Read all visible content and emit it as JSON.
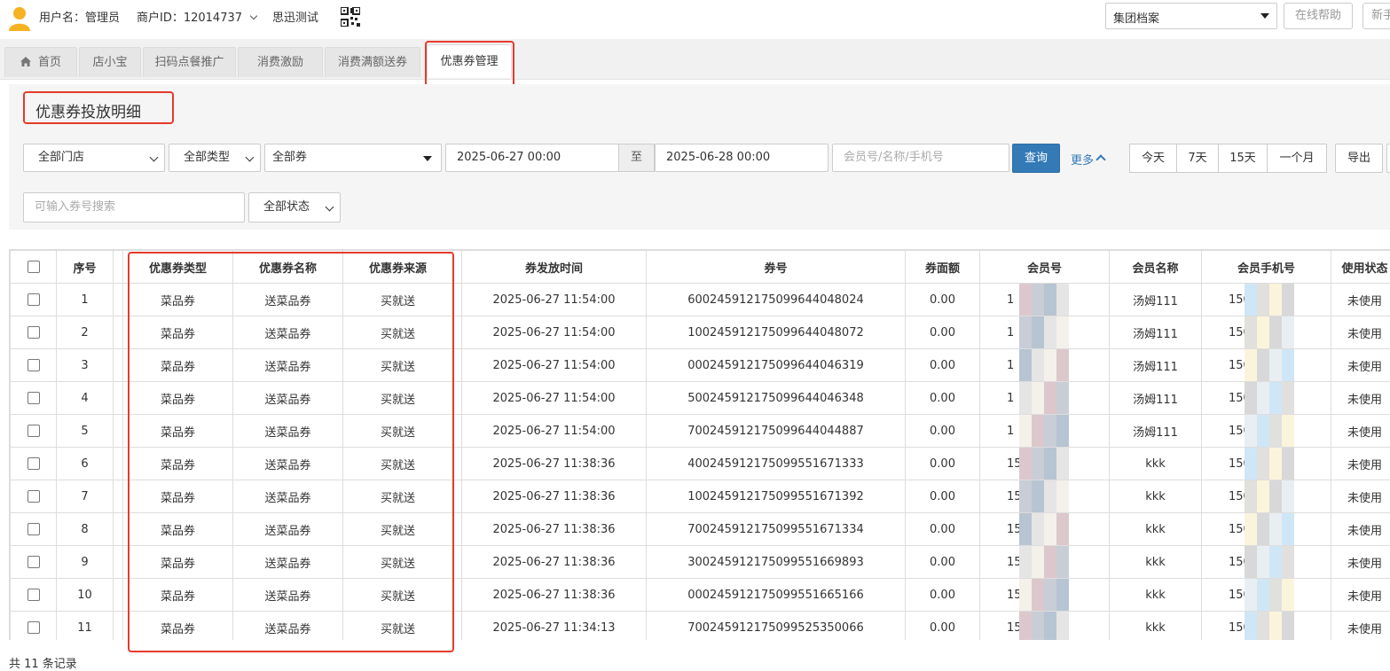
{
  "topbar": {
    "username": "用户名：管理员",
    "merchant_id": "商户ID：12014737",
    "store_name": "思迅测试",
    "group_select": "集团档案",
    "help_button": "在线帮助",
    "new_button": "新手"
  },
  "tabs": [
    {
      "label": "首页"
    },
    {
      "label": "店小宝"
    },
    {
      "label": "扫码点餐推广"
    },
    {
      "label": "消费激励"
    },
    {
      "label": "消费满额送券"
    },
    {
      "label": "优惠券管理"
    }
  ],
  "page_title": "优惠券投放明细",
  "filters": {
    "store": "全部门店",
    "type": "全部类型",
    "coupon": "全部券",
    "date_from": "2025-06-27 00:00",
    "date_to_label": "至",
    "date_to": "2025-06-28 00:00",
    "member_placeholder": "会员号/名称/手机号",
    "query_button": "查询",
    "more_link": "更多",
    "quick_ranges": [
      "今天",
      "7天",
      "15天",
      "一个月"
    ],
    "export_button": "导出",
    "coupon_no_placeholder": "可输入券号搜索",
    "status": "全部状态"
  },
  "table": {
    "headers": [
      "序号",
      "优惠券类型",
      "优惠券名称",
      "优惠券来源",
      "券发放时间",
      "券号",
      "券面额",
      "会员号",
      "会员名称",
      "会员手机号",
      "使用状态"
    ],
    "rows": [
      {
        "no": "1",
        "type": "菜品券",
        "name": "送菜品券",
        "source": "买就送",
        "time": "2025-06-27 11:54:00",
        "code": "600245912175099644048024",
        "amount": "0.00",
        "member_no": "1",
        "member_name": "汤姆111",
        "phone": "150",
        "status": "未使用"
      },
      {
        "no": "2",
        "type": "菜品券",
        "name": "送菜品券",
        "source": "买就送",
        "time": "2025-06-27 11:54:00",
        "code": "100245912175099644048072",
        "amount": "0.00",
        "member_no": "1",
        "member_name": "汤姆111",
        "phone": "150",
        "status": "未使用"
      },
      {
        "no": "3",
        "type": "菜品券",
        "name": "送菜品券",
        "source": "买就送",
        "time": "2025-06-27 11:54:00",
        "code": "000245912175099644046319",
        "amount": "0.00",
        "member_no": "1",
        "member_name": "汤姆111",
        "phone": "150",
        "status": "未使用"
      },
      {
        "no": "4",
        "type": "菜品券",
        "name": "送菜品券",
        "source": "买就送",
        "time": "2025-06-27 11:54:00",
        "code": "500245912175099644046348",
        "amount": "0.00",
        "member_no": "1",
        "member_name": "汤姆111",
        "phone": "150",
        "status": "未使用"
      },
      {
        "no": "5",
        "type": "菜品券",
        "name": "送菜品券",
        "source": "买就送",
        "time": "2025-06-27 11:54:00",
        "code": "700245912175099644044887",
        "amount": "0.00",
        "member_no": "1",
        "member_name": "汤姆111",
        "phone": "150",
        "status": "未使用"
      },
      {
        "no": "6",
        "type": "菜品券",
        "name": "送菜品券",
        "source": "买就送",
        "time": "2025-06-27 11:38:36",
        "code": "400245912175099551671333",
        "amount": "0.00",
        "member_no": "15",
        "member_name": "kkk",
        "phone": "150",
        "status": "未使用"
      },
      {
        "no": "7",
        "type": "菜品券",
        "name": "送菜品券",
        "source": "买就送",
        "time": "2025-06-27 11:38:36",
        "code": "100245912175099551671392",
        "amount": "0.00",
        "member_no": "15",
        "member_name": "kkk",
        "phone": "150",
        "status": "未使用"
      },
      {
        "no": "8",
        "type": "菜品券",
        "name": "送菜品券",
        "source": "买就送",
        "time": "2025-06-27 11:38:36",
        "code": "700245912175099551671334",
        "amount": "0.00",
        "member_no": "15",
        "member_name": "kkk",
        "phone": "150",
        "status": "未使用"
      },
      {
        "no": "9",
        "type": "菜品券",
        "name": "送菜品券",
        "source": "买就送",
        "time": "2025-06-27 11:38:36",
        "code": "300245912175099551669893",
        "amount": "0.00",
        "member_no": "15",
        "member_name": "kkk",
        "phone": "150",
        "status": "未使用"
      },
      {
        "no": "10",
        "type": "菜品券",
        "name": "送菜品券",
        "source": "买就送",
        "time": "2025-06-27 11:38:36",
        "code": "000245912175099551665166",
        "amount": "0.00",
        "member_no": "15",
        "member_name": "kkk",
        "phone": "150",
        "status": "未使用"
      },
      {
        "no": "11",
        "type": "菜品券",
        "name": "送菜品券",
        "source": "买就送",
        "time": "2025-06-27 11:34:13",
        "code": "700245912175099525350066",
        "amount": "0.00",
        "member_no": "15",
        "member_name": "kkk",
        "phone": "150",
        "status": "未使用"
      }
    ]
  },
  "footer": {
    "record_count": "共 11 条记录"
  },
  "colors": {
    "highlight": "#e53b2c",
    "primary": "#337ab7",
    "avatar": "#f5b223"
  }
}
